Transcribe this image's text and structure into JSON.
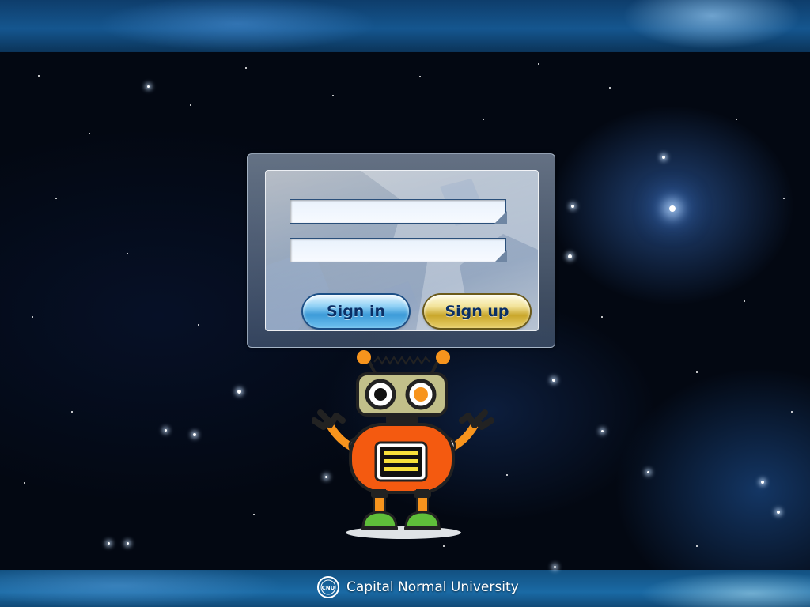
{
  "login": {
    "username": {
      "value": "",
      "placeholder": ""
    },
    "password": {
      "value": "",
      "placeholder": ""
    },
    "signin_label": "Sign in",
    "signup_label": "Sign up"
  },
  "footer": {
    "university_name": "Capital Normal University",
    "logo_text": "CNU"
  },
  "colors": {
    "signin_button": "#3c9bd8",
    "signup_button": "#c9a72b",
    "robot_body": "#f45a10",
    "robot_head": "#c2c08a",
    "robot_feet": "#5fbf3a"
  },
  "icons": [
    "university-logo-icon",
    "robot-mascot"
  ]
}
